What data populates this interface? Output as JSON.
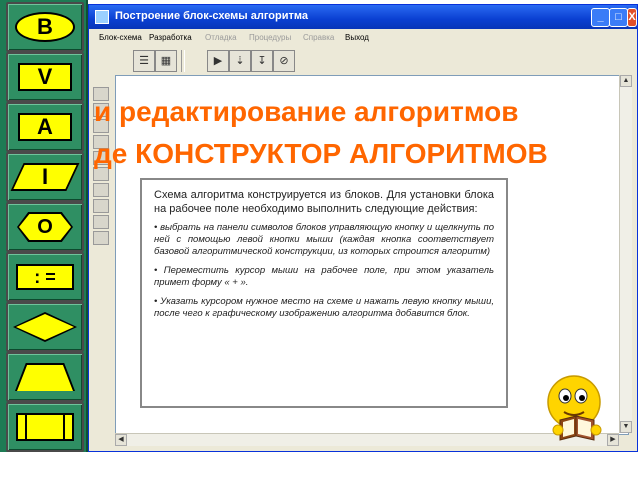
{
  "palette": {
    "buttons": [
      {
        "label": "B",
        "shape": "oval"
      },
      {
        "label": "V",
        "shape": "rect"
      },
      {
        "label": "A",
        "shape": "rect"
      },
      {
        "label": "I",
        "shape": "parallelogram"
      },
      {
        "label": "O",
        "shape": "hexagon"
      },
      {
        "label": ": =",
        "shape": "rect"
      },
      {
        "label": "",
        "shape": "diamond"
      },
      {
        "label": "",
        "shape": "trapezoid"
      },
      {
        "label": "",
        "shape": "subroutine"
      }
    ],
    "colors": {
      "background": "#1e7b54",
      "shape_fill": "#ffff00"
    }
  },
  "window": {
    "title": "Построение блок-схемы алгоритма",
    "controls": {
      "minimize": "_",
      "maximize": "□",
      "close": "X"
    },
    "menu": [
      {
        "label": "Блок-схема",
        "enabled": true
      },
      {
        "label": "Разработка",
        "enabled": true
      },
      {
        "label": "Отладка",
        "enabled": false
      },
      {
        "label": "Процедуры",
        "enabled": false
      },
      {
        "label": "Справка",
        "enabled": false
      },
      {
        "label": "Выход",
        "enabled": true
      }
    ],
    "toolbar_icons": [
      "list-icon",
      "grid-icon",
      "play-icon",
      "step-into-icon",
      "step-over-icon",
      "stop-icon"
    ]
  },
  "heading": {
    "line1": "и редактирование алгоритмов",
    "line2": "де КОНСТРУКТОР АЛГОРИТМОВ",
    "color": "#ff6600"
  },
  "info": {
    "intro": "Схема алгоритма конструируется из блоков. Для установки блока на рабочее поле необходимо выполнить следующие действия:",
    "items": [
      "выбрать на панели символов блоков управляющую кнопку и щелкнуть по ней с помощью левой кнопки мыши (каждая кнопка соответствует базовой алгоритмической конструкции, из которых строится алгоритм)",
      "Переместить курсор мыши на рабочее поле, при этом указатель примет форму « + ».",
      "Указать курсором нужное место на схеме и нажать левую кнопку мыши, после чего к графическому изображению алгоритма добавится блок."
    ]
  }
}
